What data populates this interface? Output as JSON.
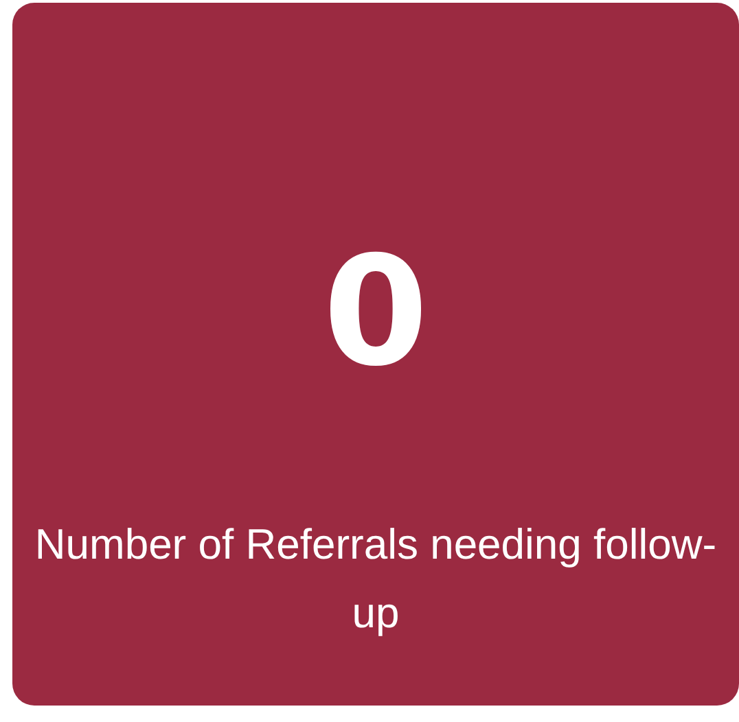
{
  "tile": {
    "count": "0",
    "label": "Number of Referrals needing follow-up"
  }
}
